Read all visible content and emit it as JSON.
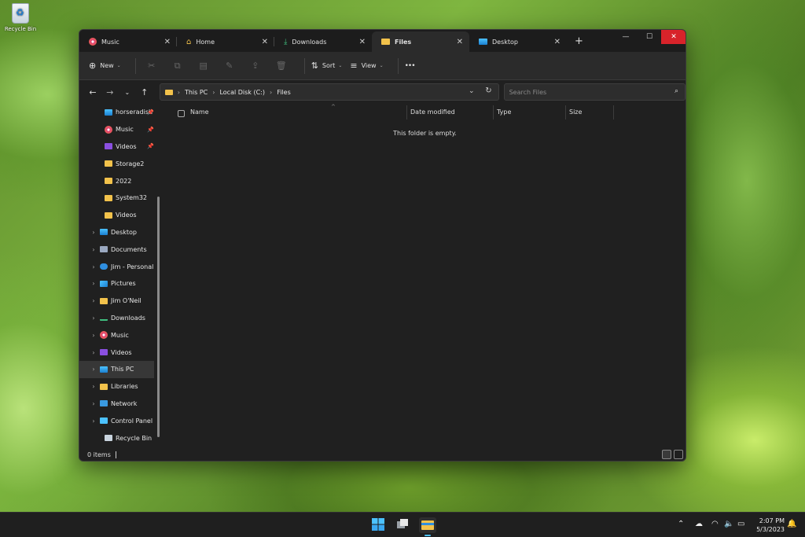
{
  "desktop": {
    "recycle_bin_label": "Recycle Bin"
  },
  "window": {
    "tabs": [
      {
        "label": "Music",
        "icon": "music-icon",
        "active": false
      },
      {
        "label": "Home",
        "icon": "home-icon",
        "active": false
      },
      {
        "label": "Downloads",
        "icon": "download-icon",
        "active": false
      },
      {
        "label": "Files",
        "icon": "folder-icon",
        "active": true
      },
      {
        "label": "Desktop",
        "icon": "desktop-icon",
        "active": false
      }
    ],
    "new_tab": "+",
    "controls": {
      "minimize": "—",
      "maximize": "☐",
      "close": "✕"
    }
  },
  "toolbar": {
    "new_label": "New",
    "sort_label": "Sort",
    "view_label": "View",
    "more_label": "•••"
  },
  "address": {
    "crumbs": [
      "This PC",
      "Local Disk (C:)",
      "Files"
    ],
    "search_placeholder": "Search Files"
  },
  "sidebar": {
    "items": [
      {
        "label": "horseradish",
        "icon": "monitor-icon",
        "pinned": true,
        "expandable": false
      },
      {
        "label": "Music",
        "icon": "music-icon",
        "pinned": true,
        "expandable": false
      },
      {
        "label": "Videos",
        "icon": "video-icon",
        "pinned": true,
        "expandable": false
      },
      {
        "label": "Storage2",
        "icon": "folder-icon",
        "pinned": false,
        "expandable": false
      },
      {
        "label": "2022",
        "icon": "folder-icon",
        "pinned": false,
        "expandable": false
      },
      {
        "label": "System32",
        "icon": "folder-icon",
        "pinned": false,
        "expandable": false
      },
      {
        "label": "Videos",
        "icon": "folder-icon",
        "pinned": false,
        "expandable": false
      },
      {
        "label": "Desktop",
        "icon": "desktop-icon",
        "pinned": false,
        "expandable": true
      },
      {
        "label": "Documents",
        "icon": "document-icon",
        "pinned": false,
        "expandable": true
      },
      {
        "label": "Jim - Personal",
        "icon": "cloud-icon",
        "pinned": false,
        "expandable": true
      },
      {
        "label": "Pictures",
        "icon": "picture-icon",
        "pinned": false,
        "expandable": true
      },
      {
        "label": "Jim O'Neil",
        "icon": "folder-icon",
        "pinned": false,
        "expandable": true
      },
      {
        "label": "Downloads",
        "icon": "download-icon",
        "pinned": false,
        "expandable": true
      },
      {
        "label": "Music",
        "icon": "music-icon",
        "pinned": false,
        "expandable": true
      },
      {
        "label": "Videos",
        "icon": "video-icon",
        "pinned": false,
        "expandable": true
      },
      {
        "label": "This PC",
        "icon": "monitor-icon",
        "pinned": false,
        "expandable": true,
        "selected": true
      },
      {
        "label": "Libraries",
        "icon": "folder-icon",
        "pinned": false,
        "expandable": true
      },
      {
        "label": "Network",
        "icon": "network-icon",
        "pinned": false,
        "expandable": true
      },
      {
        "label": "Control Panel",
        "icon": "control-panel-icon",
        "pinned": false,
        "expandable": true
      },
      {
        "label": "Recycle Bin",
        "icon": "recycle-bin-icon",
        "pinned": false,
        "expandable": false
      }
    ]
  },
  "content": {
    "columns": [
      "Name",
      "Date modified",
      "Type",
      "Size"
    ],
    "empty_message": "This folder is empty."
  },
  "status": {
    "items_count": "0 items"
  },
  "taskbar": {
    "time": "2:07 PM",
    "date": "5/3/2023"
  },
  "colors": {
    "accent": "#4cc2ff",
    "folder": "#f2c24b",
    "close_red": "#d8232a",
    "window_bg": "#202020"
  }
}
